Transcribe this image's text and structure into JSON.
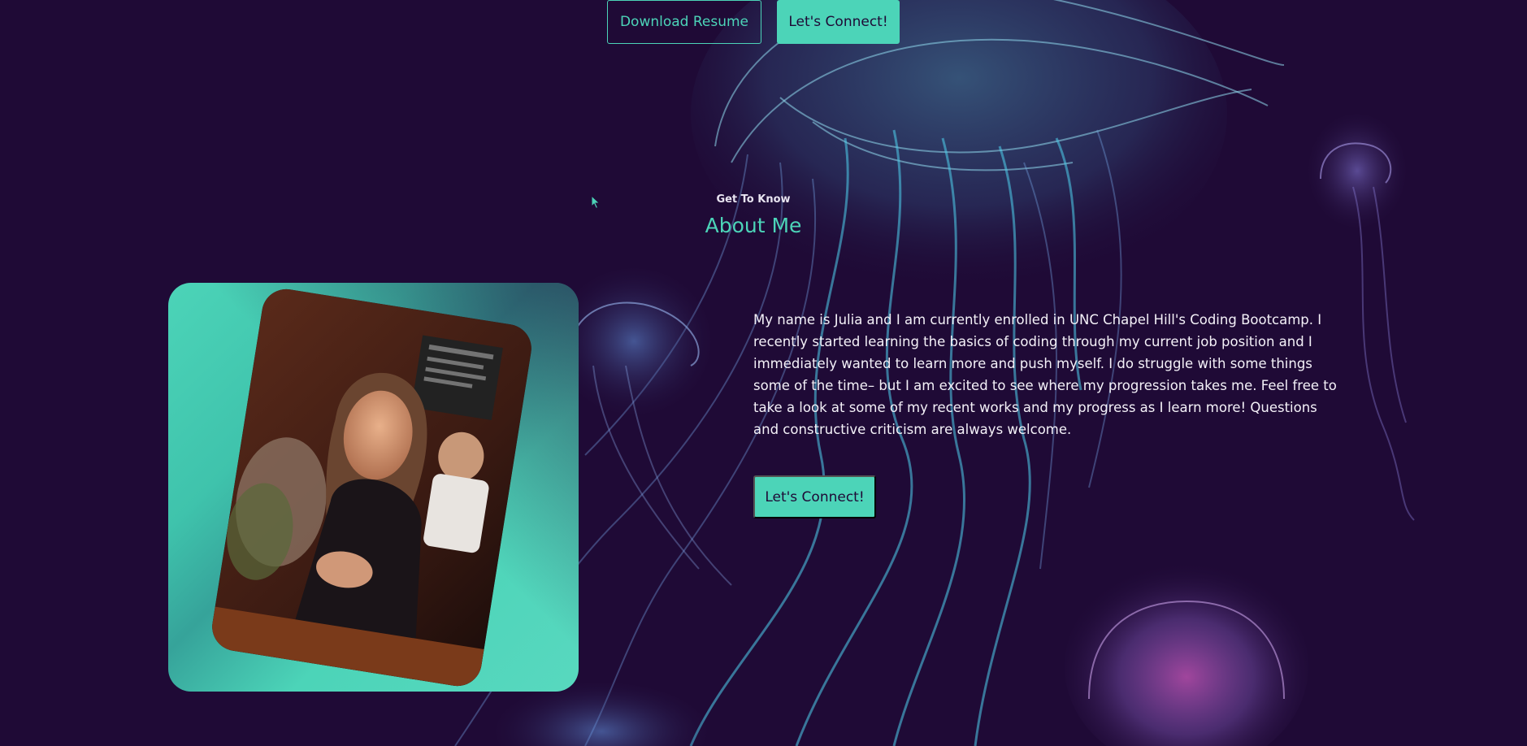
{
  "hero": {
    "download_resume_label": "Download Resume",
    "lets_connect_label": "Let's Connect!"
  },
  "about": {
    "subtitle": "Get To Know",
    "title": "About Me",
    "bio": "My name is Julia and I am currently enrolled in UNC Chapel Hill's Coding Bootcamp. I recently started learning the basics of coding through my current job position and I immediately wanted to learn more and push myself. I do struggle with some things some of the time– but I am excited to see where my progression takes me. Feel free to take a look at some of my recent works and my progress as I learn more! Questions and constructive criticism are always welcome.",
    "connect_label": "Let's Connect!"
  },
  "colors": {
    "background": "#1f0a36",
    "accent": "#4cd4b8",
    "text": "#f4f1f8"
  },
  "icons": {
    "background_art": "jellyfish-illustration",
    "cursor": "mouse-pointer-icon"
  }
}
